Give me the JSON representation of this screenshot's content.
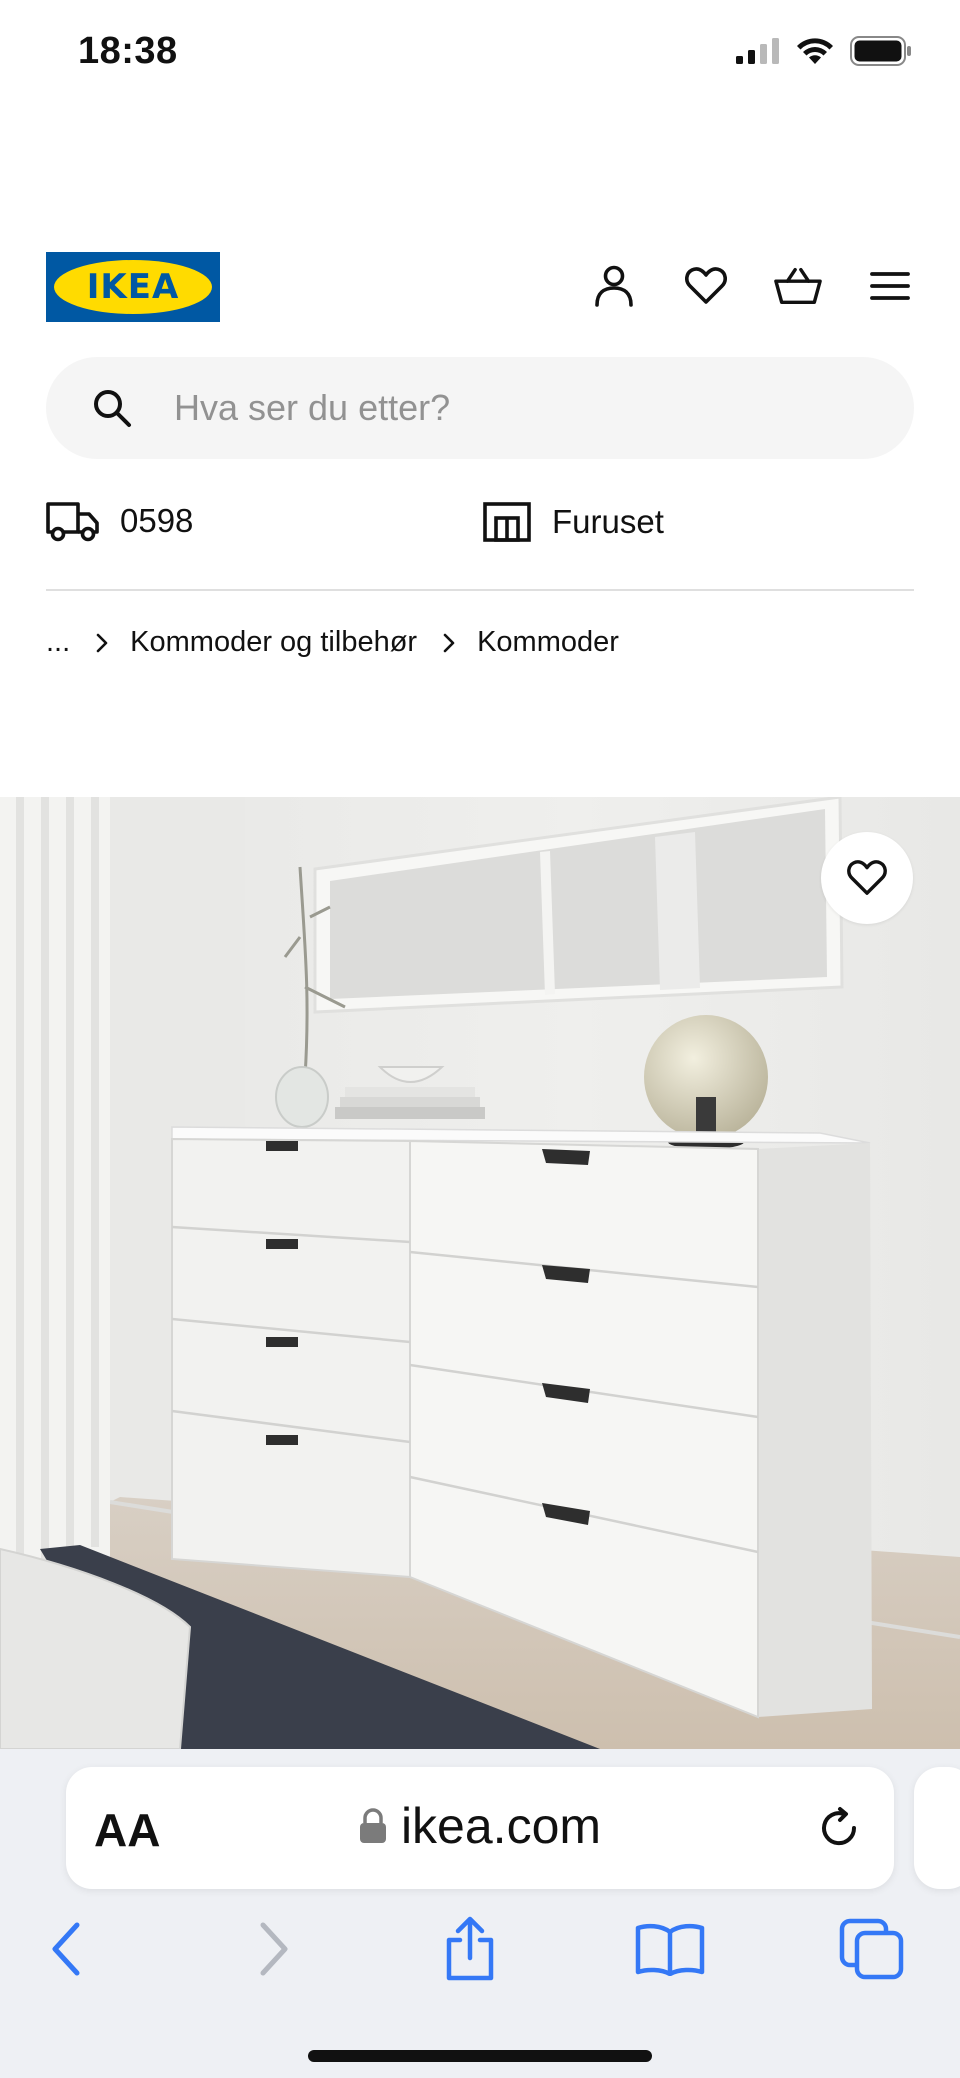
{
  "status_bar": {
    "time": "18:38",
    "signal_icon": "cellular-signal-icon",
    "wifi_icon": "wifi-icon",
    "battery_icon": "battery-icon"
  },
  "header": {
    "logo_text": "IKEA",
    "icons": [
      "user-icon",
      "heart-icon",
      "basket-icon",
      "menu-icon"
    ]
  },
  "search": {
    "placeholder": "Hva ser du etter?"
  },
  "location": {
    "postcode": "0598",
    "store": "Furuset"
  },
  "breadcrumb": {
    "ellipsis": "...",
    "items": [
      "Kommoder og tilbehør",
      "Kommoder"
    ]
  },
  "safari": {
    "aa_label": "AA",
    "url": "ikea.com"
  },
  "colors": {
    "ikea_blue": "#0058a3",
    "ikea_yellow": "#ffdb00",
    "safari_blue": "#3478f6"
  }
}
